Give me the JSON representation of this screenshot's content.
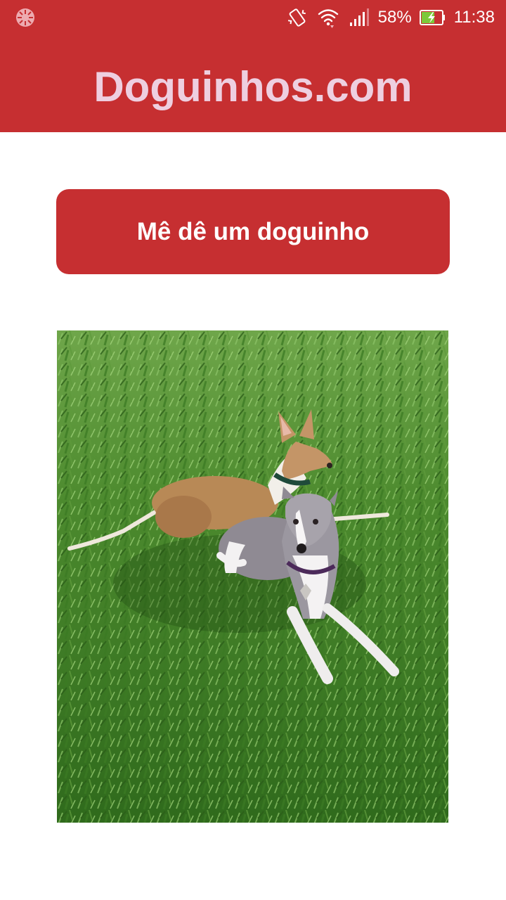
{
  "status_bar": {
    "left_icon": "loading-spinner-icon",
    "icons": [
      "vibrate-icon",
      "wifi-icon",
      "signal-icon",
      "battery-charging-icon"
    ],
    "battery_percent": "58%",
    "time": "11:38"
  },
  "app_bar": {
    "title": "Doguinhos.com",
    "background_color": "#c62f31",
    "title_color": "#eecfe0"
  },
  "main": {
    "button_label": "Mê dê um doguinho",
    "image": {
      "content": "dog-photo",
      "dogs": [
        "tan-greyhound",
        "grey-white-greyhound"
      ]
    }
  }
}
